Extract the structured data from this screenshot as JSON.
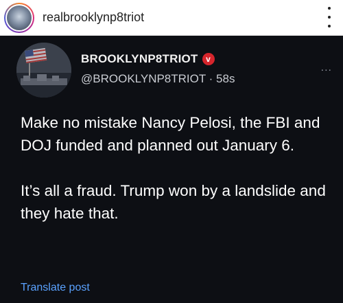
{
  "instagram_header": {
    "username": "realbrooklynp8triot",
    "avatar_icon": "profile-avatar",
    "more_icon": "vertical-ellipsis-icon"
  },
  "post": {
    "display_name": "BROOKLYNP8TRIOT",
    "verified_badge_glyph": "v",
    "handle_and_time": "@BROOKLYNP8TRIOT · 58s",
    "more_label": "...",
    "paragraphs": [
      "Make no mistake Nancy Pelosi, the FBI and DOJ funded and planned out January 6.",
      "It’s all a fraud. Trump won by a landslide and they hate that."
    ],
    "translate_label": "Translate post"
  },
  "colors": {
    "post_background": "#0d0f14",
    "post_text": "#ffffff",
    "link": "#5aa2ff",
    "verified_badge": "#d6252c"
  }
}
